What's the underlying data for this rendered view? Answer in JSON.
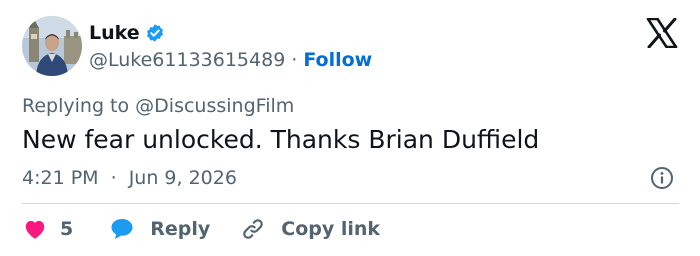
{
  "user": {
    "display_name": "Luke",
    "handle": "@Luke61133615489",
    "separator": "·",
    "follow_label": "Follow"
  },
  "reply_context": {
    "prefix": "Replying to",
    "mention": "@DiscussingFilm"
  },
  "tweet": {
    "text": "New fear unlocked. Thanks Brian Duffield",
    "time": "4:21 PM",
    "separator": "·",
    "date": "Jun 9, 2026"
  },
  "actions": {
    "like_count": "5",
    "reply_label": "Reply",
    "copy_link_label": "Copy link"
  },
  "icons": {
    "brand": "x-logo-icon",
    "verified": "verified-badge-icon",
    "info": "info-icon",
    "like": "heart-icon",
    "reply": "speech-bubble-icon",
    "copy": "link-icon"
  },
  "colors": {
    "text": "#0f1419",
    "secondary": "#536471",
    "accent": "#1d9bf0",
    "follow": "#006fd6",
    "like": "#f91880",
    "divider": "#cfd9de"
  }
}
